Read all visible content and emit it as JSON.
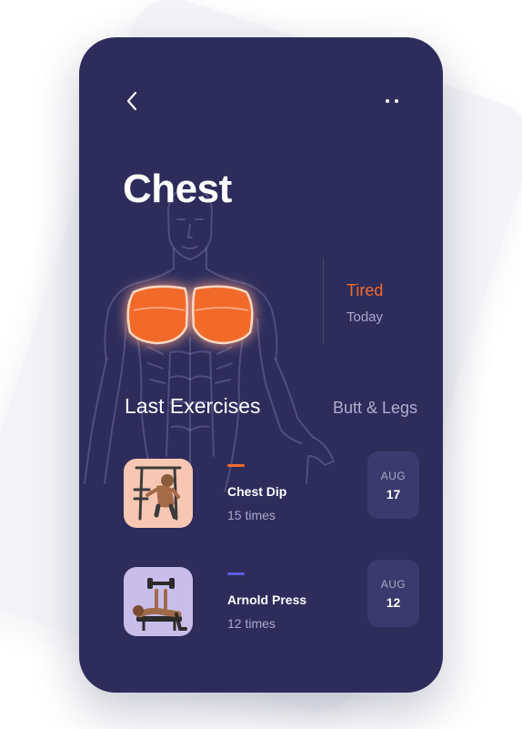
{
  "header": {
    "back_icon": "chevron-left-icon",
    "more_icon": "more-dots-icon"
  },
  "muscle": {
    "title": "Chest",
    "status": "Tired",
    "status_time": "Today",
    "status_color": "#f26b2b"
  },
  "section": {
    "title": "Last Exercises",
    "alt_link": "Butt & Legs"
  },
  "exercises": [
    {
      "name": "Chest Dip",
      "count": "15 times",
      "month": "AUG",
      "day": "17",
      "accent_color": "#f26b2b",
      "thumb_bg": "#f7c7b3"
    },
    {
      "name": "Arnold Press",
      "count": "12 times",
      "month": "AUG",
      "day": "12",
      "accent_color": "#5a5ce0",
      "thumb_bg": "#c9bdea"
    }
  ],
  "colors": {
    "card_bg": "#2d2c5b",
    "badge_bg": "#3b3a6e",
    "highlight": "#f26b2b"
  }
}
